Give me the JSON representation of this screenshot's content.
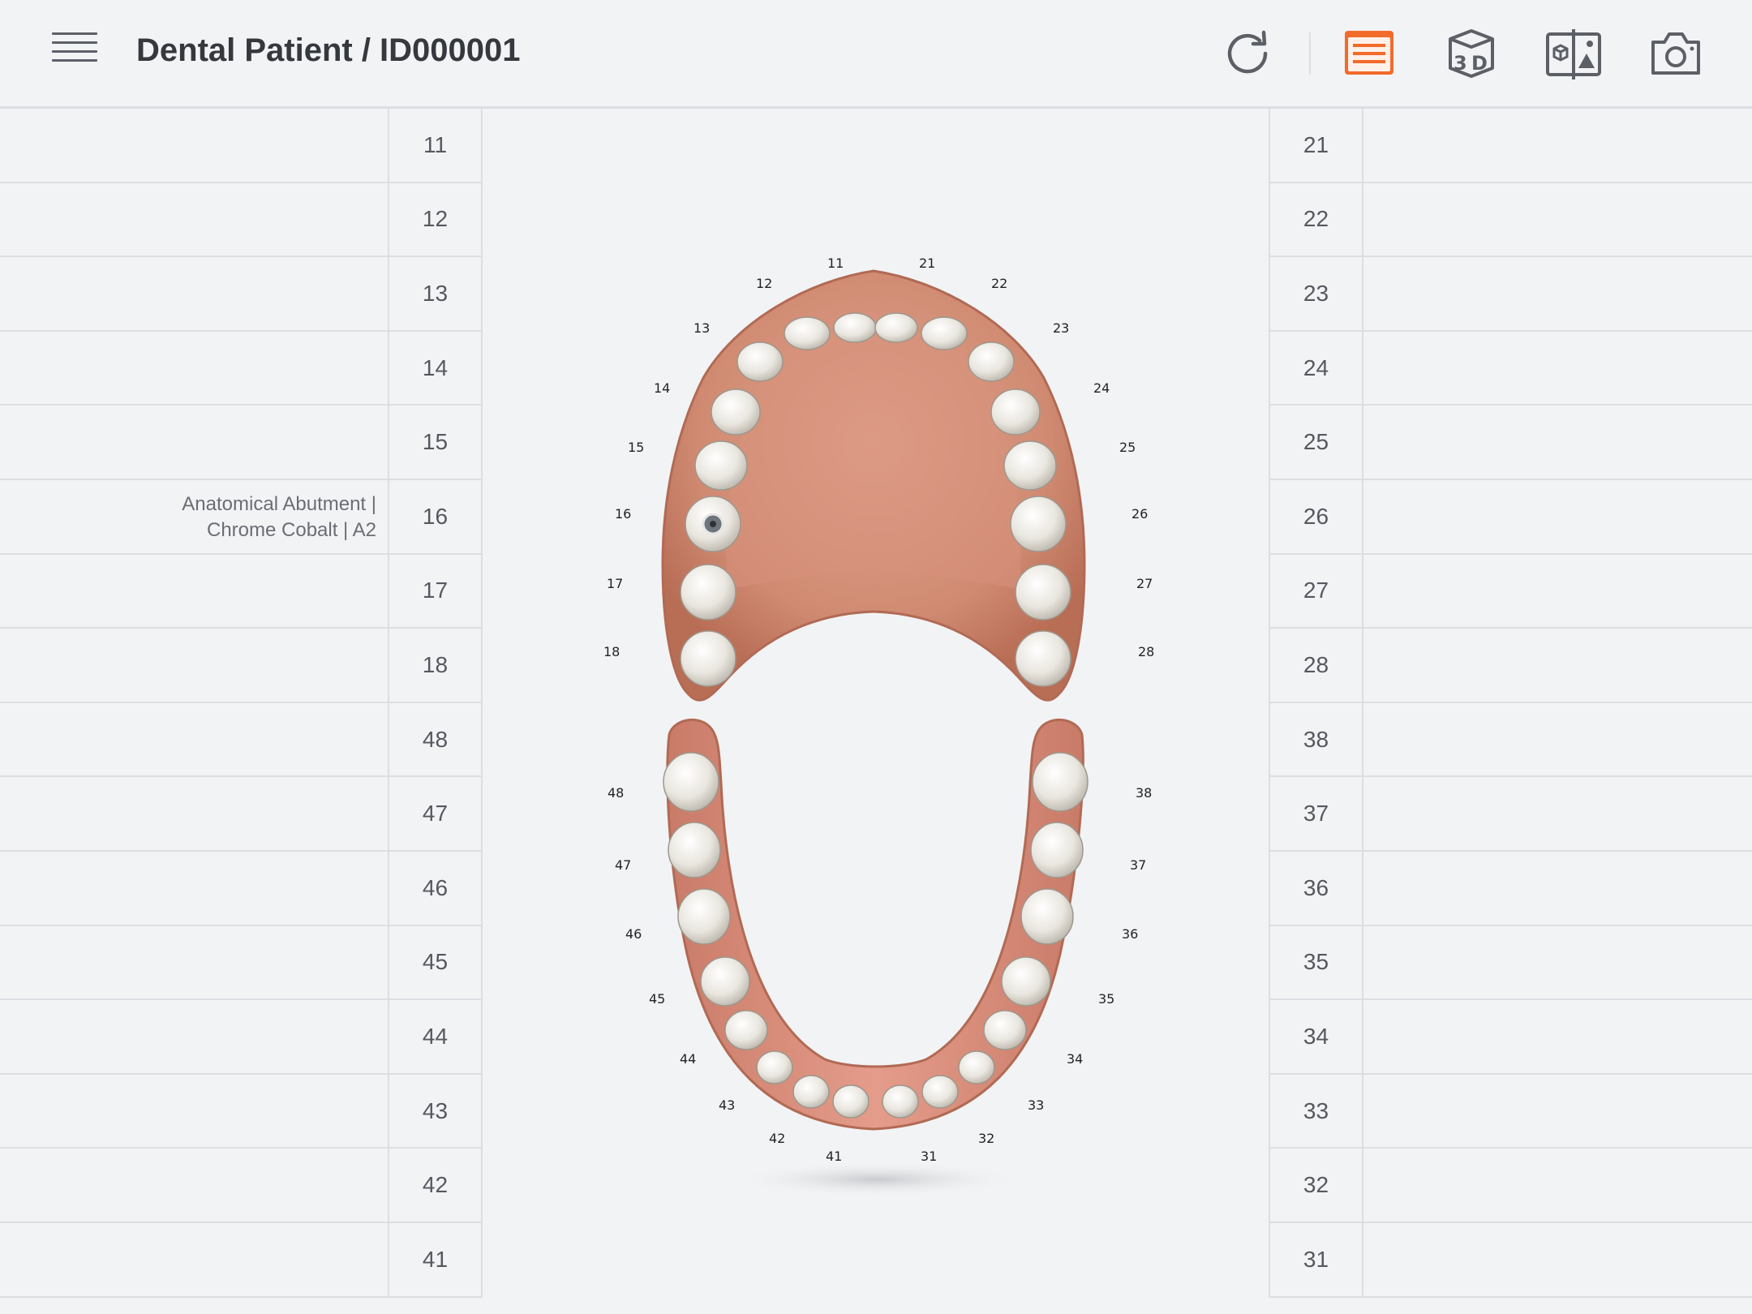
{
  "header": {
    "title": "Dental Patient / ID000001",
    "tools": [
      {
        "name": "refresh-icon",
        "active": false
      },
      {
        "name": "list-view-icon",
        "active": true
      },
      {
        "name": "3d-view-icon",
        "active": false
      },
      {
        "name": "model-image-compare-icon",
        "active": false
      },
      {
        "name": "camera-icon",
        "active": false
      }
    ],
    "accent_color": "#f26b2a"
  },
  "left_rows": [
    {
      "num": "11",
      "text": ""
    },
    {
      "num": "12",
      "text": ""
    },
    {
      "num": "13",
      "text": ""
    },
    {
      "num": "14",
      "text": ""
    },
    {
      "num": "15",
      "text": ""
    },
    {
      "num": "16",
      "text": "Anatomical Abutment |\nChrome Cobalt | A2"
    },
    {
      "num": "17",
      "text": ""
    },
    {
      "num": "18",
      "text": ""
    },
    {
      "num": "48",
      "text": ""
    },
    {
      "num": "47",
      "text": ""
    },
    {
      "num": "46",
      "text": ""
    },
    {
      "num": "45",
      "text": ""
    },
    {
      "num": "44",
      "text": ""
    },
    {
      "num": "43",
      "text": ""
    },
    {
      "num": "42",
      "text": ""
    },
    {
      "num": "41",
      "text": ""
    }
  ],
  "right_rows": [
    {
      "num": "21"
    },
    {
      "num": "22"
    },
    {
      "num": "23"
    },
    {
      "num": "24"
    },
    {
      "num": "25"
    },
    {
      "num": "26"
    },
    {
      "num": "27"
    },
    {
      "num": "28"
    },
    {
      "num": "38"
    },
    {
      "num": "37"
    },
    {
      "num": "36"
    },
    {
      "num": "35"
    },
    {
      "num": "34"
    },
    {
      "num": "33"
    },
    {
      "num": "32"
    },
    {
      "num": "31"
    }
  ],
  "dental_chart": {
    "upper_teeth": [
      "11",
      "12",
      "13",
      "14",
      "15",
      "16",
      "17",
      "18",
      "21",
      "22",
      "23",
      "24",
      "25",
      "26",
      "27",
      "28"
    ],
    "lower_teeth": [
      "31",
      "32",
      "33",
      "34",
      "35",
      "36",
      "37",
      "38",
      "41",
      "42",
      "43",
      "44",
      "45",
      "46",
      "47",
      "48"
    ],
    "marked_teeth": [
      "16"
    ]
  }
}
